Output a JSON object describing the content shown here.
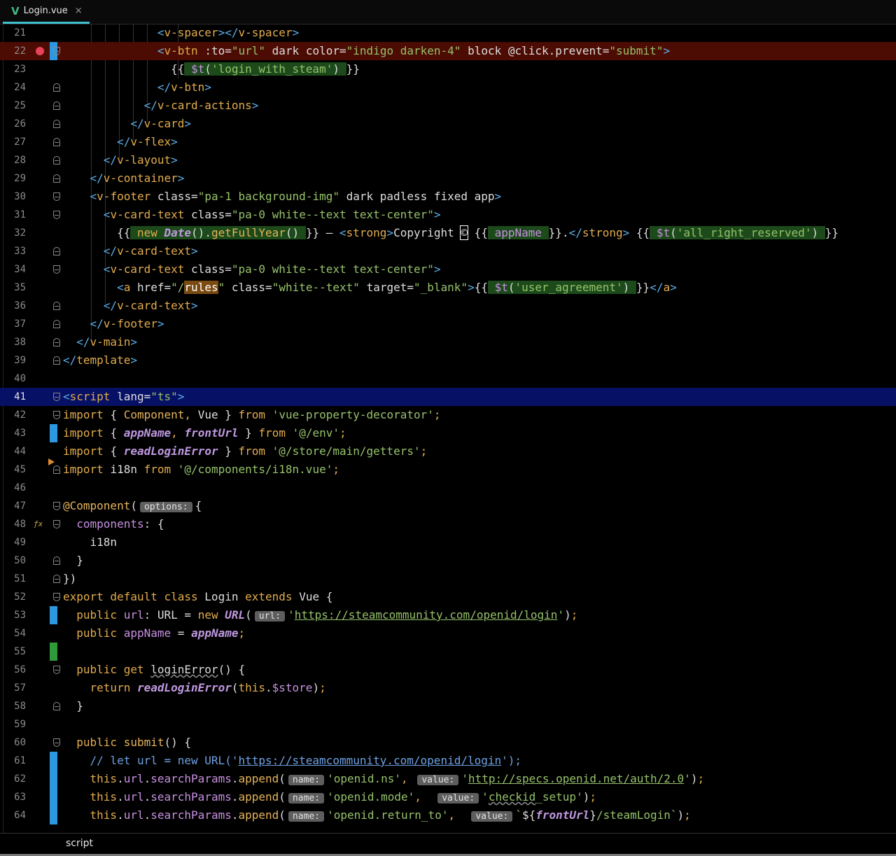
{
  "tab": {
    "icon": "vue-logo-icon",
    "label": "Login.vue",
    "close": "×"
  },
  "status": {
    "breadcrumb": "script"
  },
  "lines": [
    {
      "n": "21",
      "t": "                <v-spacer></v-spacer>"
    },
    {
      "n": "22",
      "t": "                <v-btn :to=\"url\" dark color=\"indigo darken-4\" block @click.prevent=\"submit\">"
    },
    {
      "n": "23",
      "t": "                  {{ $t('login_with_steam') }}"
    },
    {
      "n": "24",
      "t": "                </v-btn>"
    },
    {
      "n": "25",
      "t": "              </v-card-actions>"
    },
    {
      "n": "26",
      "t": "            </v-card>"
    },
    {
      "n": "27",
      "t": "          </v-flex>"
    },
    {
      "n": "28",
      "t": "        </v-layout>"
    },
    {
      "n": "29",
      "t": "      </v-container>"
    },
    {
      "n": "30",
      "t": "      <v-footer class=\"pa-1 background-img\" dark padless fixed app>"
    },
    {
      "n": "31",
      "t": "        <v-card-text class=\"pa-0 white--text text-center\">"
    },
    {
      "n": "32",
      "t": "          {{ new Date().getFullYear() }} — <strong>Copyright © {{ appName }}.</strong> {{ $t('all_right_reserved') }}"
    },
    {
      "n": "33",
      "t": "        </v-card-text>"
    },
    {
      "n": "34",
      "t": "        <v-card-text class=\"pa-0 white--text text-center\">"
    },
    {
      "n": "35",
      "t": "          <a href=\"/rules\" class=\"white--text\" target=\"_blank\">{{ $t('user_agreement') }}</a>"
    },
    {
      "n": "36",
      "t": "        </v-card-text>"
    },
    {
      "n": "37",
      "t": "      </v-footer>"
    },
    {
      "n": "38",
      "t": "    </v-main>"
    },
    {
      "n": "39",
      "t": "</template>"
    },
    {
      "n": "40",
      "t": ""
    },
    {
      "n": "41",
      "t": "<script lang=\"ts\">"
    },
    {
      "n": "42",
      "t": "import { Component, Vue } from 'vue-property-decorator';"
    },
    {
      "n": "43",
      "t": "import { appName, frontUrl } from '@/env';"
    },
    {
      "n": "44",
      "t": "import { readLoginError } from '@/store/main/getters';"
    },
    {
      "n": "45",
      "t": "import i18n from '@/components/i18n.vue';"
    },
    {
      "n": "46",
      "t": ""
    },
    {
      "n": "47",
      "t": "@Component( options: {"
    },
    {
      "n": "48",
      "t": "  components: {"
    },
    {
      "n": "49",
      "t": "    i18n"
    },
    {
      "n": "50",
      "t": "  }"
    },
    {
      "n": "51",
      "t": "})"
    },
    {
      "n": "52",
      "t": "export default class Login extends Vue {"
    },
    {
      "n": "53",
      "t": "  public url: URL = new URL( url: 'https://steamcommunity.com/openid/login');"
    },
    {
      "n": "54",
      "t": "  public appName = appName;"
    },
    {
      "n": "55",
      "t": ""
    },
    {
      "n": "56",
      "t": "  public get loginError() {"
    },
    {
      "n": "57",
      "t": "    return readLoginError(this.$store);"
    },
    {
      "n": "58",
      "t": "  }"
    },
    {
      "n": "59",
      "t": ""
    },
    {
      "n": "60",
      "t": "  public submit() {"
    },
    {
      "n": "61",
      "t": "    // let url = new URL('https://steamcommunity.com/openid/login');"
    },
    {
      "n": "62",
      "t": "    this.url.searchParams.append( name: 'openid.ns',  value: 'http://specs.openid.net/auth/2.0');"
    },
    {
      "n": "63",
      "t": "    this.url.searchParams.append( name: 'openid.mode',  value: 'checkid_setup');"
    },
    {
      "n": "64",
      "t": "    this.url.searchParams.append( name: 'openid.return_to',  value: `${frontUrl}/steamLogin`);"
    }
  ]
}
